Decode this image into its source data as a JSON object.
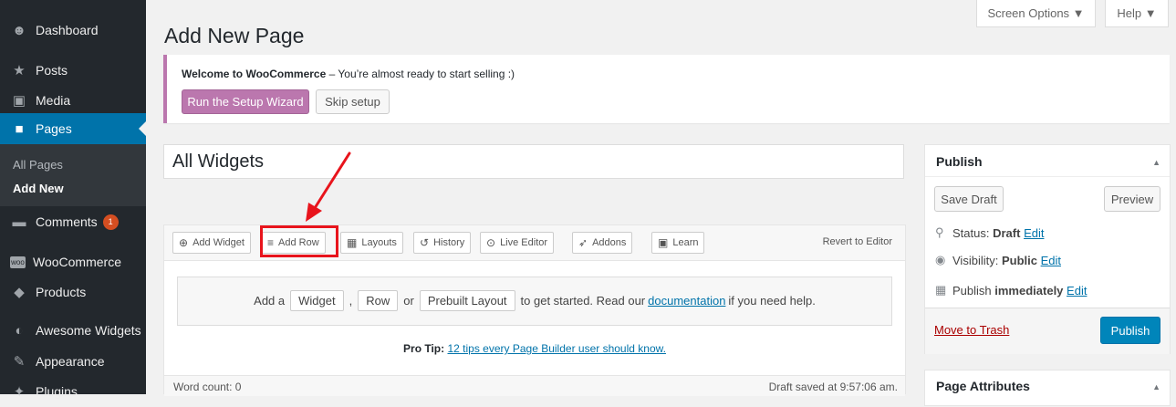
{
  "sidebar": {
    "items": [
      {
        "label": "Dashboard",
        "icon": "dashboard-icon",
        "glyph": "☻"
      },
      {
        "label": "Posts",
        "icon": "pushpin-icon",
        "glyph": "★"
      },
      {
        "label": "Media",
        "icon": "media-icon",
        "glyph": "▣"
      },
      {
        "label": "Pages",
        "icon": "pages-icon",
        "glyph": "■"
      },
      {
        "label": "Comments",
        "icon": "comments-icon",
        "glyph": "▬",
        "badge": "1"
      },
      {
        "label": "WooCommerce",
        "icon": "woocommerce-icon",
        "glyph": "woo"
      },
      {
        "label": "Products",
        "icon": "products-icon",
        "glyph": "◆"
      },
      {
        "label": "Awesome Widgets",
        "icon": "awesome-widgets-icon",
        "glyph": "◐"
      },
      {
        "label": "Appearance",
        "icon": "appearance-icon",
        "glyph": "✎"
      },
      {
        "label": "Plugins",
        "icon": "plugins-icon",
        "glyph": "✦"
      }
    ],
    "submenu": {
      "all_pages": "All Pages",
      "add_new": "Add New"
    }
  },
  "screen_tabs": {
    "screen_options": "Screen Options ▼",
    "help": "Help ▼"
  },
  "page_title": "Add New Page",
  "notice": {
    "title": "Welcome to WooCommerce",
    "message": " – You’re almost ready to start selling :)",
    "setup_button": "Run the Setup Wizard",
    "skip_button": "Skip setup",
    "accent_color": "#bb77ae"
  },
  "title_input": {
    "value": "All Widgets"
  },
  "builder": {
    "toolbar": {
      "add_widget": "Add Widget",
      "add_row": "Add Row",
      "layouts": "Layouts",
      "history": "History",
      "live_editor": "Live Editor",
      "addons": "Addons",
      "learn": "Learn",
      "revert": "Revert to Editor"
    },
    "empty": {
      "add_a": "Add a",
      "widget": "Widget",
      "comma": ",",
      "row": "Row",
      "or": "or",
      "prebuilt": "Prebuilt Layout",
      "to_get_started": "to get started. Read our",
      "documentation": "documentation",
      "if_help": "if you need help."
    },
    "pro_tip_label": "Pro Tip:",
    "pro_tip_link": "12 tips every Page Builder user should know."
  },
  "status_bar": {
    "word_count": "Word count: 0",
    "draft_saved": "Draft saved at 9:57:06 am."
  },
  "publish": {
    "title": "Publish",
    "save_draft": "Save Draft",
    "preview": "Preview",
    "status_label": "Status:",
    "status_value": "Draft",
    "visibility_label": "Visibility:",
    "visibility_value": "Public",
    "publish_label": "Publish",
    "publish_value": "immediately",
    "edit": "Edit",
    "move_to_trash": "Move to Trash",
    "publish_button": "Publish"
  },
  "page_attributes": {
    "title": "Page Attributes"
  },
  "colors": {
    "admin_blue": "#0073aa",
    "sidebar_bg": "#23282d",
    "annotation_red": "#e8141c"
  }
}
